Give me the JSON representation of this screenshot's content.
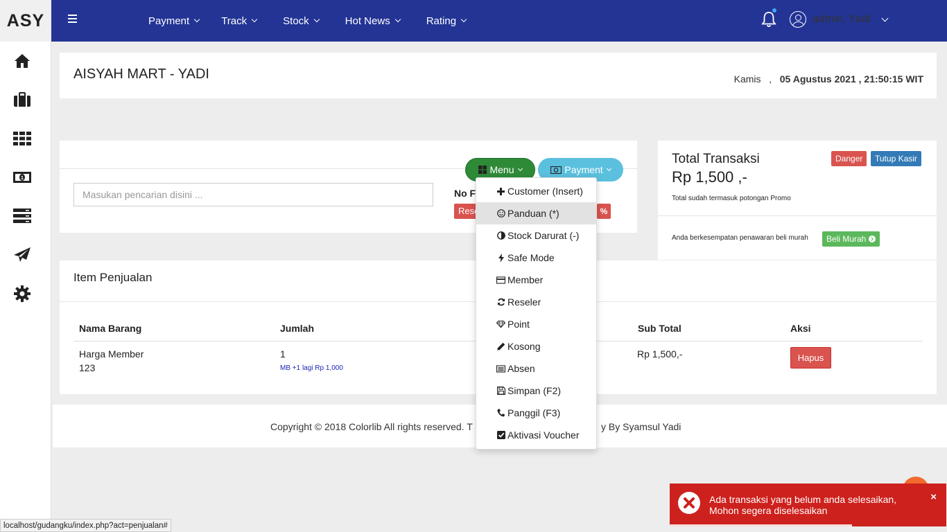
{
  "brand": "ASY",
  "topnav": [
    {
      "label": "Payment"
    },
    {
      "label": "Track"
    },
    {
      "label": "Stock"
    },
    {
      "label": "Hot News"
    },
    {
      "label": "Rating"
    }
  ],
  "user": {
    "name": "admin, Yadi"
  },
  "sidebar_icons": [
    "home-icon",
    "briefcase-icon",
    "grid-icon",
    "money-icon",
    "server-icon",
    "send-icon",
    "gear-icon"
  ],
  "header": {
    "title": "AISYAH MART - YADI",
    "day": "Kamis",
    "separator": ",",
    "date": "05 Agustus 2021 , 21:50:15 WIT"
  },
  "search": {
    "placeholder": "Masukan pencarian disini ...",
    "nof_label": "No F",
    "reset_label": "Rese",
    "percent_label": "%"
  },
  "buttons": {
    "menu": "Menu",
    "payment": "Payment"
  },
  "total": {
    "title": "Total Transaksi",
    "value": "Rp 1,500 ,-",
    "note": "Total sudah termasuk potongan Promo",
    "promo_text": "Anda berkesempatan penawaran beli murah",
    "beli_label": "Beli Murah",
    "danger_label": "Danger",
    "tutup_label": "Tutup Kasir"
  },
  "items": {
    "title": "Item Penjualan",
    "columns": [
      "Nama Barang",
      "Jumlah",
      "Sub Total",
      "Aksi"
    ],
    "rows": [
      {
        "name": "Harga Member",
        "code": "123",
        "qty": "1",
        "note": "MB +1 lagi Rp 1,000",
        "subtotal": "Rp 1,500,-",
        "action": "Hapus"
      }
    ]
  },
  "footer": {
    "left": "Copyright © 2018 Colorlib All rights reserved. T",
    "right": "y By Syamsul Yadi"
  },
  "dropdown": [
    {
      "label": "Customer (Insert)",
      "icon": "plus-icon",
      "active": false
    },
    {
      "label": "Panduan (*)",
      "icon": "smile-icon",
      "active": true
    },
    {
      "label": "Stock Darurat (-)",
      "icon": "half-circle-icon",
      "active": false
    },
    {
      "label": "Safe Mode",
      "icon": "bolt-icon",
      "active": false
    },
    {
      "label": "Member",
      "icon": "card-icon",
      "active": false
    },
    {
      "label": "Reseler",
      "icon": "refresh-icon",
      "active": false
    },
    {
      "label": "Point",
      "icon": "diamond-icon",
      "active": false
    },
    {
      "label": "Kosong",
      "icon": "pencil-icon",
      "active": false
    },
    {
      "label": "Absen",
      "icon": "list-icon",
      "active": false
    },
    {
      "label": "Simpan (F2)",
      "icon": "save-icon",
      "active": false
    },
    {
      "label": "Panggil (F3)",
      "icon": "phone-icon",
      "active": false
    },
    {
      "label": "Aktivasi Voucher",
      "icon": "check-square-icon",
      "active": false
    }
  ],
  "statusbar": "localhost/gudangku/index.php?act=penjualan#",
  "toast": {
    "line1": "Ada transaksi yang belum anda selesaikan,",
    "line2": "Mohon segera diselesaikan",
    "close": "×",
    "progress": 0.66
  },
  "colors": {
    "topbar": "#233495",
    "danger": "#d9534f",
    "success": "#5cb85c",
    "info": "#5bc0de",
    "primary": "#337ab7",
    "toast": "#cd211d"
  }
}
